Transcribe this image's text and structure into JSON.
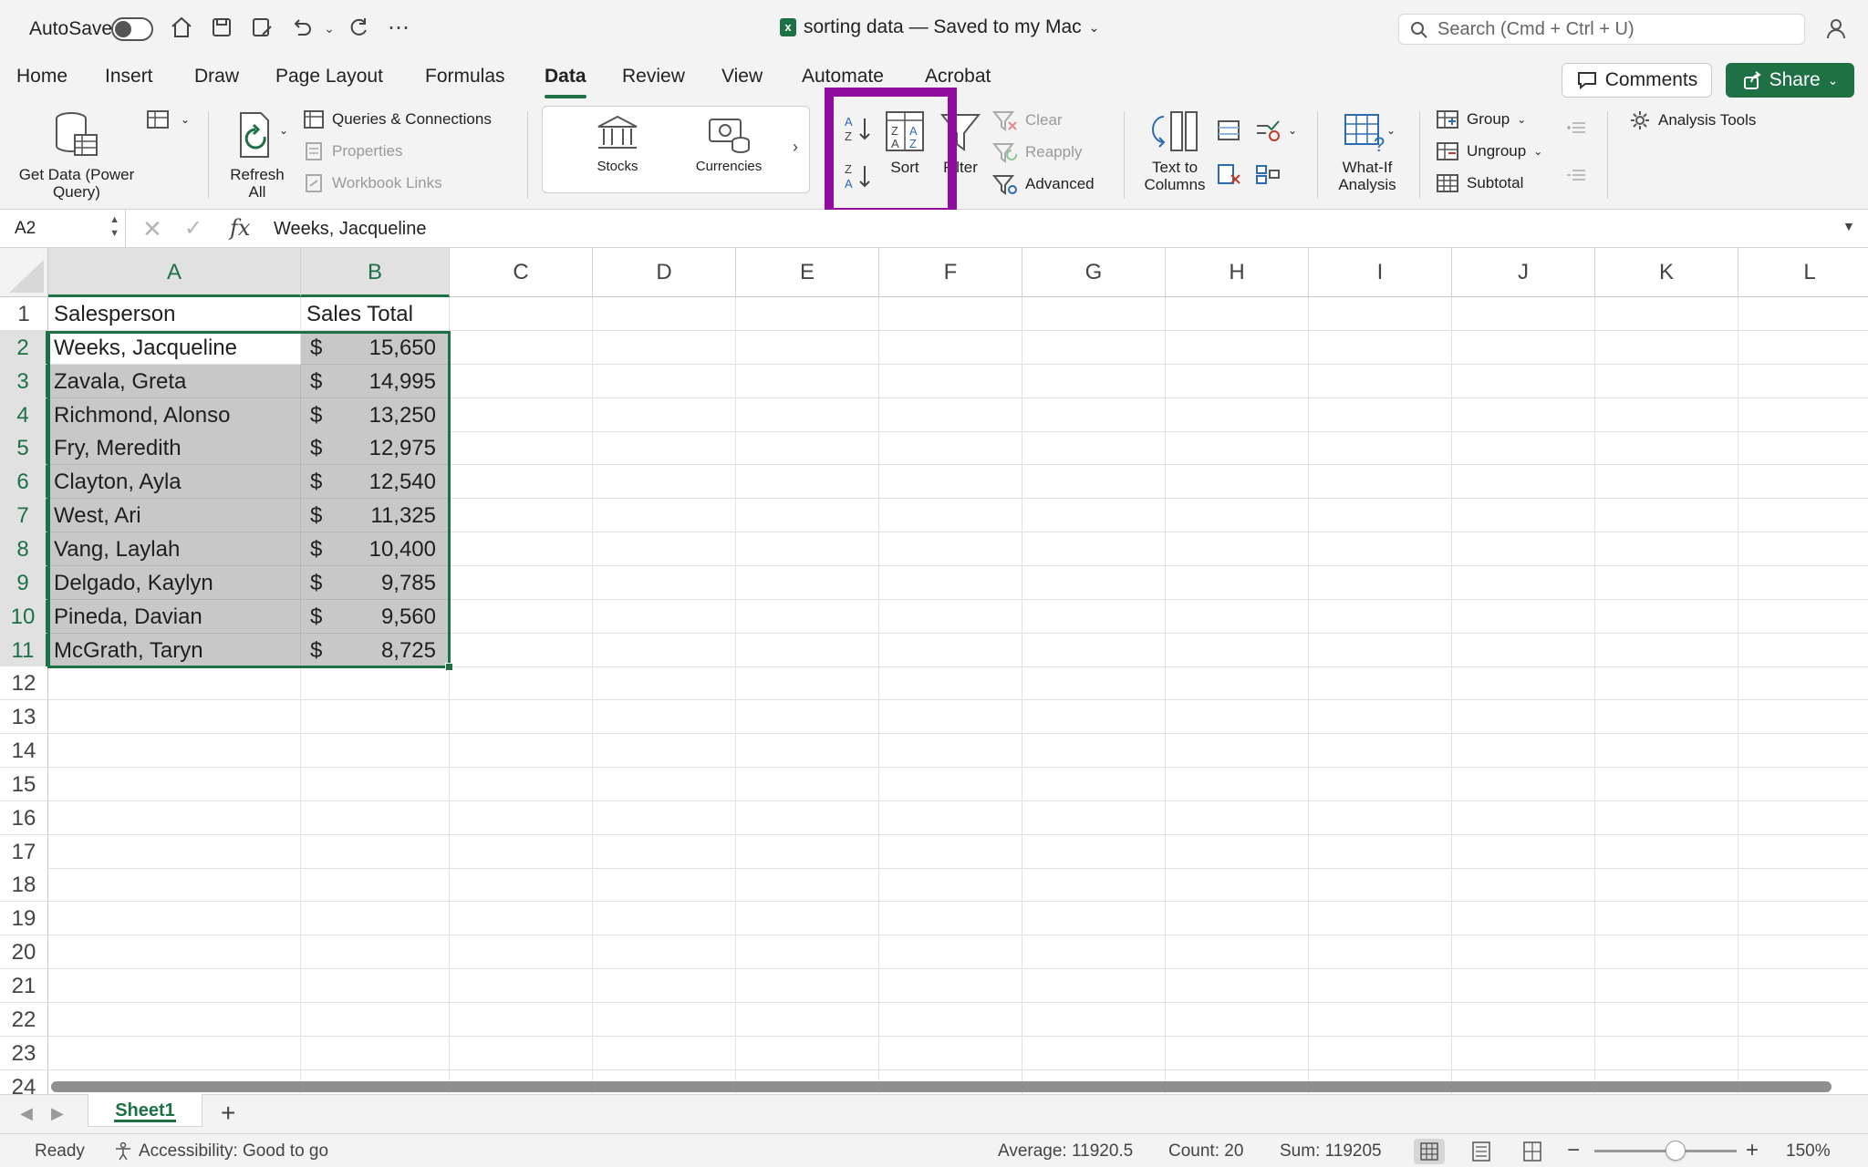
{
  "titlebar": {
    "autosave_label": "AutoSave",
    "doc_title": "sorting data — Saved to my Mac",
    "search_placeholder": "Search (Cmd + Ctrl + U)"
  },
  "tabs": [
    "Home",
    "Insert",
    "Draw",
    "Page Layout",
    "Formulas",
    "Data",
    "Review",
    "View",
    "Automate",
    "Acrobat"
  ],
  "active_tab": "Data",
  "actions": {
    "comments": "Comments",
    "share": "Share"
  },
  "ribbon": {
    "get_data": "Get Data (Power Query)",
    "refresh_all": "Refresh All",
    "queries_connections": "Queries & Connections",
    "properties": "Properties",
    "workbook_links": "Workbook Links",
    "stocks": "Stocks",
    "currencies": "Currencies",
    "sort": "Sort",
    "filter": "Filter",
    "clear": "Clear",
    "reapply": "Reapply",
    "advanced": "Advanced",
    "text_to_columns": "Text to Columns",
    "what_if": "What-If Analysis",
    "group": "Group",
    "ungroup": "Ungroup",
    "subtotal": "Subtotal",
    "analysis_tools": "Analysis Tools"
  },
  "formula_bar": {
    "name_box": "A2",
    "value": "Weeks, Jacqueline"
  },
  "sheet": {
    "columns": [
      "A",
      "B",
      "C",
      "D",
      "E",
      "F",
      "G",
      "H",
      "I",
      "J",
      "K",
      "L"
    ],
    "rows": [
      "1",
      "2",
      "3",
      "4",
      "5",
      "6",
      "7",
      "8",
      "9",
      "10",
      "11",
      "12",
      "13",
      "14",
      "15",
      "16",
      "17",
      "18",
      "19",
      "20",
      "21",
      "22",
      "23",
      "24"
    ],
    "header": {
      "a": "Salesperson",
      "b": "Sales Total"
    },
    "currency_symbol": "$",
    "data": [
      {
        "name": "Weeks, Jacqueline",
        "amount": "15,650"
      },
      {
        "name": "Zavala, Greta",
        "amount": "14,995"
      },
      {
        "name": "Richmond, Alonso",
        "amount": "13,250"
      },
      {
        "name": "Fry, Meredith",
        "amount": "12,975"
      },
      {
        "name": "Clayton, Ayla",
        "amount": "12,540"
      },
      {
        "name": "West, Ari",
        "amount": "11,325"
      },
      {
        "name": "Vang, Laylah",
        "amount": "10,400"
      },
      {
        "name": "Delgado, Kaylyn",
        "amount": "9,785"
      },
      {
        "name": "Pineda, Davian",
        "amount": "9,560"
      },
      {
        "name": "McGrath, Taryn",
        "amount": "8,725"
      }
    ]
  },
  "sheet_tabs": {
    "active": "Sheet1",
    "add": "+"
  },
  "status": {
    "ready": "Ready",
    "accessibility": "Accessibility: Good to go",
    "average": "Average: 11920.5",
    "count": "Count: 20",
    "sum": "Sum: 119205",
    "zoom": "150%",
    "zoom_minus": "−",
    "zoom_plus": "+"
  },
  "colors": {
    "accent": "#1e7145",
    "highlight": "#8f0c9e"
  }
}
